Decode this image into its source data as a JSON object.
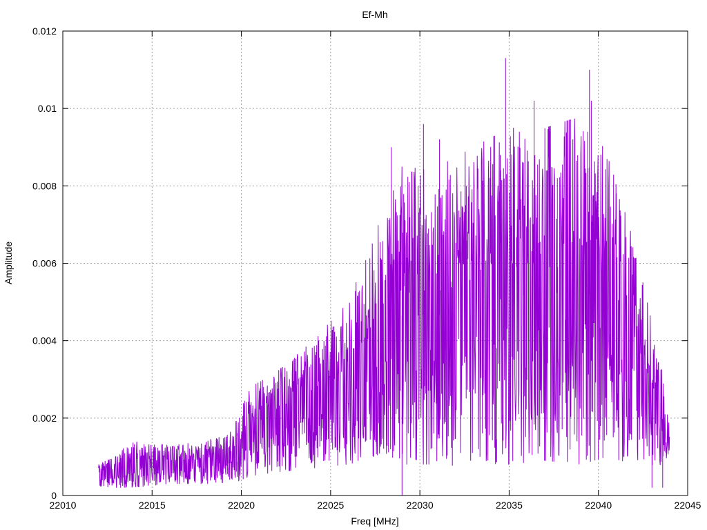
{
  "chart_data": {
    "type": "line",
    "title": "Ef-Mh",
    "xlabel": "Freq [MHz]",
    "ylabel": "Amplitude",
    "xlim": [
      22010,
      22045
    ],
    "ylim": [
      0,
      0.012
    ],
    "x_ticks": [
      "22010",
      "22015",
      "22020",
      "22025",
      "22030",
      "22035",
      "22040",
      "22045"
    ],
    "y_ticks": [
      "0",
      "0.002",
      "0.004",
      "0.006",
      "0.008",
      "0.01",
      "0.012"
    ],
    "grid": true,
    "legend": "none",
    "series": [
      {
        "color": "#9400d3",
        "x_start": 22012.0,
        "x_end": 22044.0,
        "envelope": {
          "x": [
            22012,
            22014,
            22016,
            22018,
            22019.5,
            22020.5,
            22022,
            22024,
            22026,
            22027.5,
            22029,
            22031,
            22033,
            22035,
            22037,
            22039,
            22040.5,
            22042,
            22043,
            22044
          ],
          "min": [
            0.0002,
            0.0002,
            0.0003,
            0.0003,
            0.0003,
            0.0005,
            0.0006,
            0.0007,
            0.0008,
            0.001,
            0.0008,
            0.0008,
            0.0007,
            0.0008,
            0.0009,
            0.0008,
            0.001,
            0.0008,
            0.0006,
            0.001
          ],
          "max": [
            0.0008,
            0.0014,
            0.0013,
            0.0014,
            0.0017,
            0.0028,
            0.0032,
            0.004,
            0.005,
            0.0068,
            0.0085,
            0.0085,
            0.009,
            0.0095,
            0.0095,
            0.0098,
            0.009,
            0.0065,
            0.0045,
            0.0022
          ]
        },
        "peaks": [
          {
            "x": 22028.4,
            "y": 0.009
          },
          {
            "x": 22029.9,
            "y": 0.008
          },
          {
            "x": 22030.2,
            "y": 0.0096
          },
          {
            "x": 22031.1,
            "y": 0.0092
          },
          {
            "x": 22032.6,
            "y": 0.008
          },
          {
            "x": 22034.5,
            "y": 0.0088
          },
          {
            "x": 22034.8,
            "y": 0.0113
          },
          {
            "x": 22035.8,
            "y": 0.0086
          },
          {
            "x": 22036.4,
            "y": 0.0102
          },
          {
            "x": 22037.7,
            "y": 0.0082
          },
          {
            "x": 22039.4,
            "y": 0.0094
          },
          {
            "x": 22039.5,
            "y": 0.011
          },
          {
            "x": 22039.6,
            "y": 0.0102
          },
          {
            "x": 22041.0,
            "y": 0.0078
          },
          {
            "x": 22029.0,
            "y": 0.0
          },
          {
            "x": 22043.0,
            "y": 0.0002
          },
          {
            "x": 22043.6,
            "y": 0.0002
          }
        ]
      }
    ]
  }
}
